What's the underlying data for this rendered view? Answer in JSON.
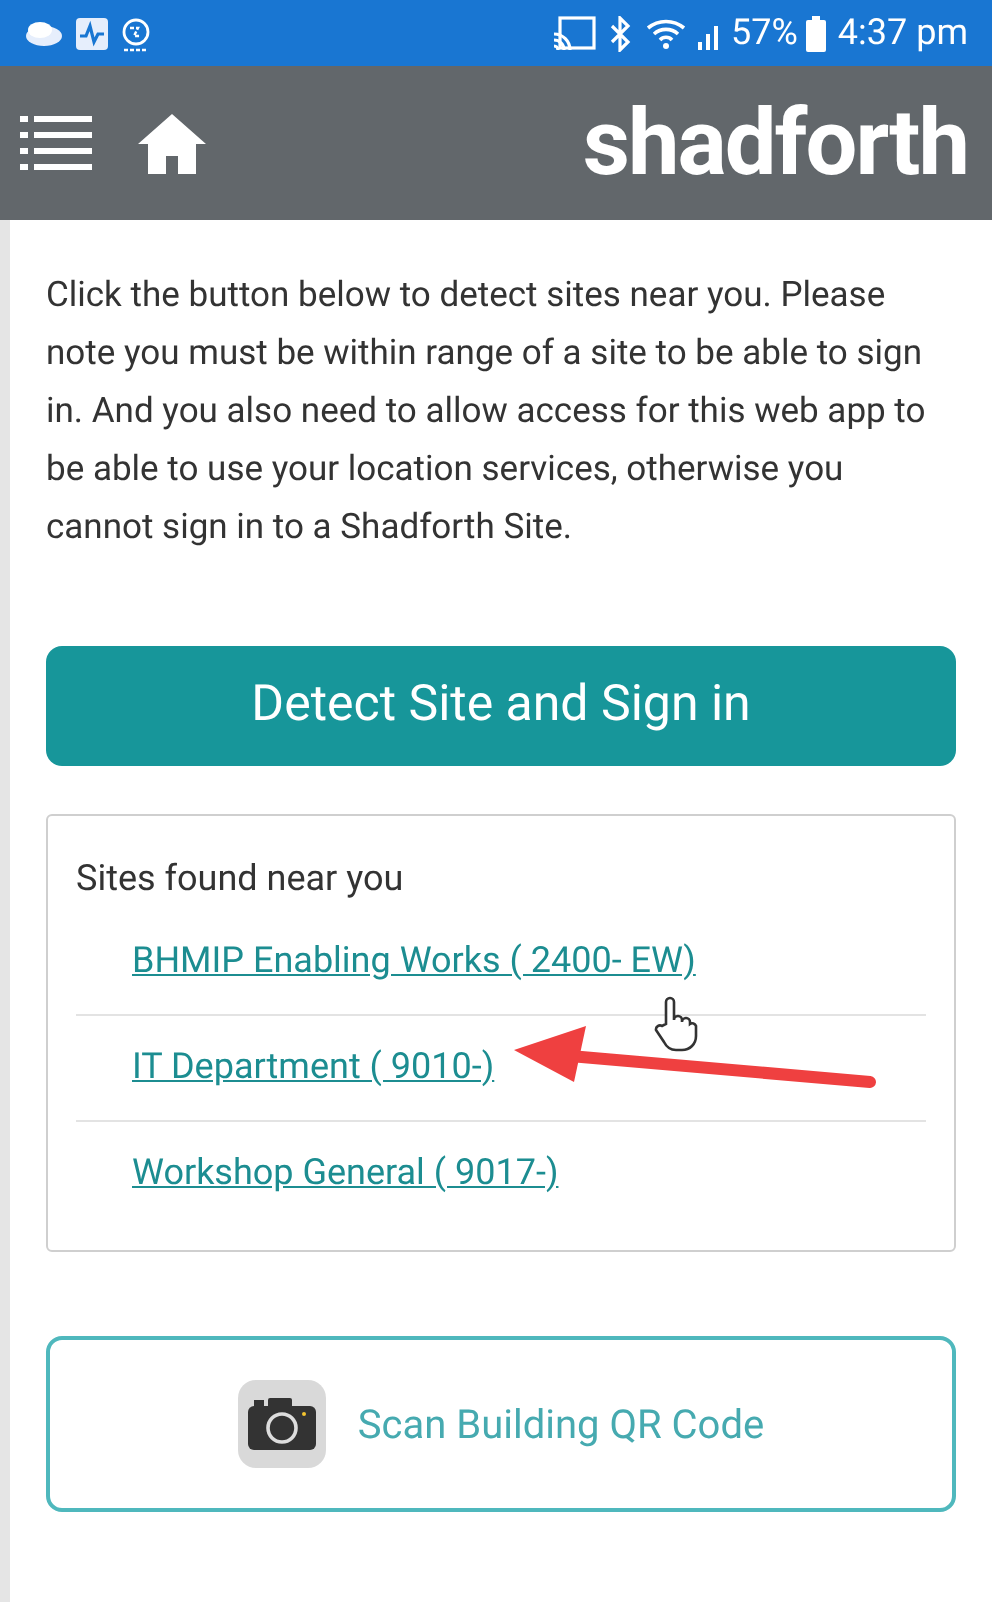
{
  "status_bar": {
    "battery": "57%",
    "time": "4:37 pm"
  },
  "header": {
    "logo": "shadforth"
  },
  "intro": "Click the button below to detect sites near you. Please note you must be within range of a site to be able to sign in. And you also need to allow access for this web app to be able to use your location services, otherwise you cannot sign in to a Shadforth Site.",
  "detect_button": "Detect Site and Sign in",
  "sites": {
    "title": "Sites found near you",
    "items": [
      {
        "label": "BHMIP Enabling Works ( 2400- EW)"
      },
      {
        "label": "IT Department ( 9010-)"
      },
      {
        "label": "Workshop General ( 9017-)"
      }
    ]
  },
  "scan_button": "Scan Building QR Code"
}
